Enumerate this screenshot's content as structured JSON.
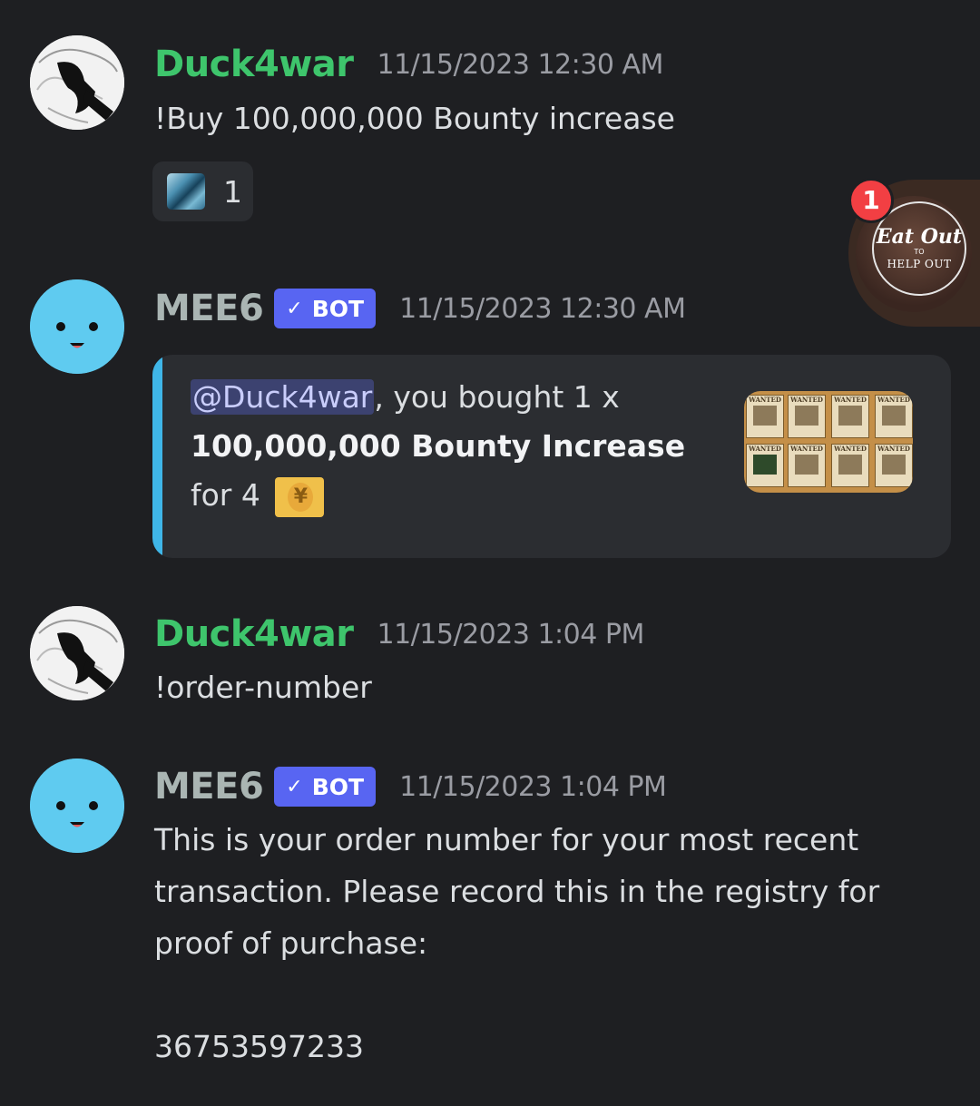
{
  "messages": [
    {
      "username": "Duck4war",
      "timestamp": "11/15/2023 12:30 AM",
      "content": "!Buy 100,000,000 Bounty increase",
      "reaction": {
        "emoji": "blue-crystal-emoji",
        "count": "1"
      }
    },
    {
      "username": "MEE6",
      "bot_badge": "BOT",
      "timestamp": "11/15/2023 12:30 AM",
      "embed": {
        "mention": "@Duck4war",
        "text_after_mention": ", you bought 1 x",
        "item_name": "100,000,000 Bounty Increase",
        "price_text": "for 4",
        "price_icon": "money-with-yen-icon",
        "thumbnail_posters": [
          "WANTED",
          "WANTED",
          "WANTED",
          "WANTED",
          "WANTED",
          "WANTED",
          "WANTED",
          "WANTED"
        ]
      }
    },
    {
      "username": "Duck4war",
      "timestamp": "11/15/2023 1:04 PM",
      "content": "!order-number"
    },
    {
      "username": "MEE6",
      "bot_badge": "BOT",
      "timestamp": "11/15/2023 1:04 PM",
      "content_lines": [
        "This is your order number for your most recent",
        "transaction. Please record this in the registry for",
        "proof of purchase:",
        "",
        "36753597233"
      ]
    }
  ],
  "floating_chat_head": {
    "title": "Eat Out",
    "to": "TO",
    "subtitle": "HELP OUT",
    "notification_count": "1"
  },
  "colors": {
    "background": "#1e1f22",
    "duck_username": "#3ec56c",
    "mee6_username": "#aab5b3",
    "bot_badge": "#5865f2",
    "embed_accent": "#3fb6e8",
    "notification": "#f23f43"
  }
}
